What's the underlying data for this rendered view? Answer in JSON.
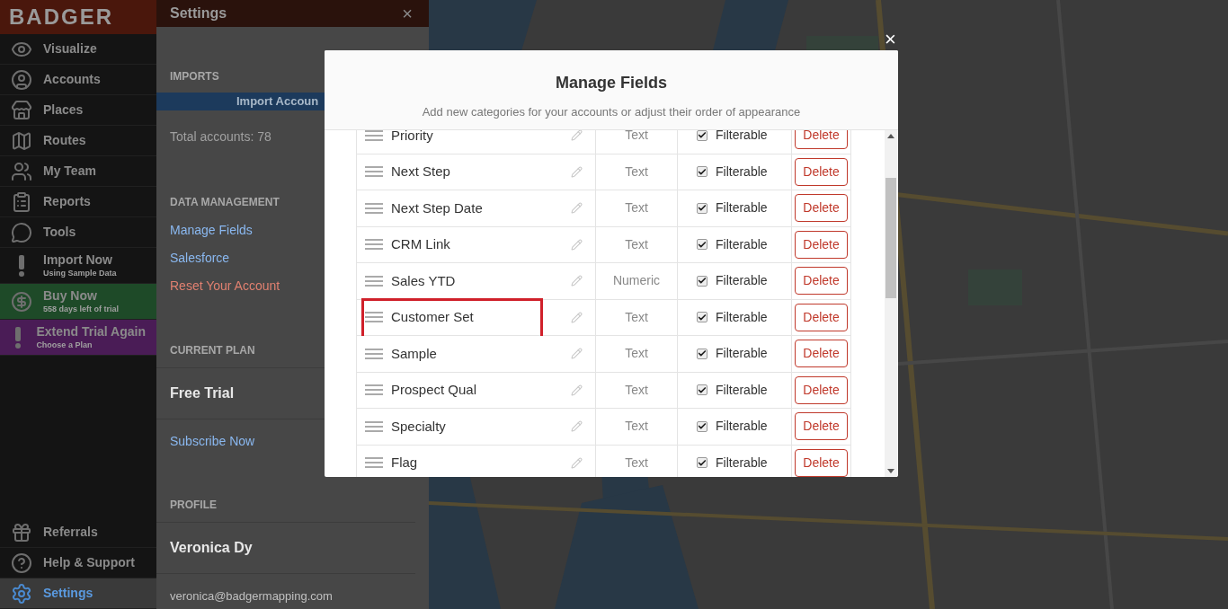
{
  "sidebar": {
    "logo": "BADGER",
    "items": [
      {
        "label": "Visualize",
        "selected": false
      },
      {
        "label": "Accounts",
        "selected": false
      },
      {
        "label": "Places",
        "selected": false
      },
      {
        "label": "Routes",
        "selected": false
      },
      {
        "label": "My Team",
        "selected": false
      },
      {
        "label": "Reports",
        "selected": false
      },
      {
        "label": "Tools",
        "selected": false
      },
      {
        "label": "Import Now",
        "sublabel": "Using Sample Data",
        "selected": false
      },
      {
        "label": "Buy Now",
        "sublabel": "558 days left of trial",
        "color": "#1e4a28",
        "selected": false
      },
      {
        "label": "Extend Trial Again",
        "sublabel": "Choose a Plan",
        "color": "#4a1c56",
        "selected": false
      }
    ],
    "bottom_items": [
      {
        "label": "Referrals",
        "selected": false
      },
      {
        "label": "Help & Support",
        "selected": false
      },
      {
        "label": "Settings",
        "selected": true
      }
    ]
  },
  "settings_panel": {
    "title": "Settings",
    "close": "×",
    "imports": {
      "heading": "IMPORTS",
      "button": "Import Accoun",
      "total": "Total accounts: 78"
    },
    "data_management": {
      "heading": "DATA MANAGEMENT",
      "links": [
        {
          "label": "Manage Fields",
          "kind": "link"
        },
        {
          "label": "Salesforce",
          "kind": "link"
        },
        {
          "label": "Reset Your Account",
          "kind": "danger"
        }
      ]
    },
    "current_plan": {
      "heading": "CURRENT PLAN",
      "plan": "Free Trial",
      "link": "Subscribe Now"
    },
    "profile": {
      "heading": "PROFILE",
      "name": "Veronica Dy",
      "email": "veronica@badgermapping.com"
    }
  },
  "modal": {
    "close": "×",
    "title": "Manage Fields",
    "subtitle": "Add new categories for your accounts or adjust their order of appearance",
    "rows": [
      {
        "name": "Priority",
        "type": "Text",
        "filterable": true,
        "filter_label": "Filterable",
        "delete": "Delete",
        "highlighted": false
      },
      {
        "name": "Next Step",
        "type": "Text",
        "filterable": true,
        "filter_label": "Filterable",
        "delete": "Delete",
        "highlighted": false
      },
      {
        "name": "Next Step Date",
        "type": "Text",
        "filterable": true,
        "filter_label": "Filterable",
        "delete": "Delete",
        "highlighted": false
      },
      {
        "name": "CRM Link",
        "type": "Text",
        "filterable": true,
        "filter_label": "Filterable",
        "delete": "Delete",
        "highlighted": false
      },
      {
        "name": "Sales YTD",
        "type": "Numeric",
        "filterable": true,
        "filter_label": "Filterable",
        "delete": "Delete",
        "highlighted": false
      },
      {
        "name": "Customer Set",
        "type": "Text",
        "filterable": true,
        "filter_label": "Filterable",
        "delete": "Delete",
        "highlighted": true
      },
      {
        "name": "Sample",
        "type": "Text",
        "filterable": true,
        "filter_label": "Filterable",
        "delete": "Delete",
        "highlighted": false
      },
      {
        "name": "Prospect Qual",
        "type": "Text",
        "filterable": true,
        "filter_label": "Filterable",
        "delete": "Delete",
        "highlighted": false
      },
      {
        "name": "Specialty",
        "type": "Text",
        "filterable": true,
        "filter_label": "Filterable",
        "delete": "Delete",
        "highlighted": false
      },
      {
        "name": "Flag",
        "type": "Text",
        "filterable": true,
        "filter_label": "Filterable",
        "delete": "Delete",
        "highlighted": false
      }
    ]
  }
}
